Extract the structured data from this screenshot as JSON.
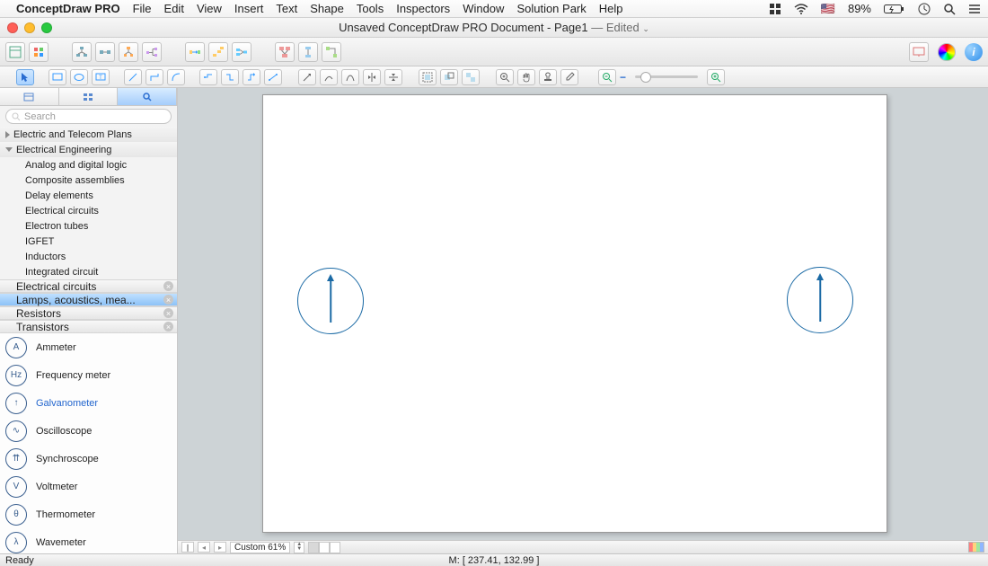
{
  "menubar": {
    "app_name": "ConceptDraw PRO",
    "items": [
      "File",
      "Edit",
      "View",
      "Insert",
      "Text",
      "Shape",
      "Tools",
      "Inspectors",
      "Window",
      "Solution Park",
      "Help"
    ],
    "battery": "89%"
  },
  "titlebar": {
    "doc": "Unsaved ConceptDraw PRO Document - Page1",
    "status": "Edited"
  },
  "sidebar": {
    "search_placeholder": "Search",
    "groups": [
      {
        "label": "Electric and Telecom Plans",
        "expanded": false
      },
      {
        "label": "Electrical Engineering",
        "expanded": true,
        "children": [
          "Analog and digital logic",
          "Composite assemblies",
          "Delay elements",
          "Electrical circuits",
          "Electron tubes",
          "IGFET",
          "Inductors",
          "Integrated circuit"
        ]
      }
    ],
    "open_categories": [
      {
        "label": "Electrical circuits",
        "selected": false
      },
      {
        "label": "Lamps, acoustics, mea...",
        "selected": true
      },
      {
        "label": "Resistors",
        "selected": false
      },
      {
        "label": "Transistors",
        "selected": false
      }
    ],
    "shapes": [
      {
        "glyph": "A",
        "label": "Ammeter",
        "selected": false
      },
      {
        "glyph": "Hz",
        "label": "Frequency meter",
        "selected": false
      },
      {
        "glyph": "↑",
        "label": "Galvanometer",
        "selected": true
      },
      {
        "glyph": "∿",
        "label": "Oscilloscope",
        "selected": false
      },
      {
        "glyph": "⇈",
        "label": "Synchroscope",
        "selected": false
      },
      {
        "glyph": "V",
        "label": "Voltmeter",
        "selected": false
      },
      {
        "glyph": "θ",
        "label": "Thermometer",
        "selected": false
      },
      {
        "glyph": "λ",
        "label": "Wavemeter",
        "selected": false
      }
    ]
  },
  "canvas_footer": {
    "zoom_label": "Custom 61%"
  },
  "status": {
    "ready": "Ready",
    "mouse": "M: [ 237.41, 132.99 ]"
  }
}
